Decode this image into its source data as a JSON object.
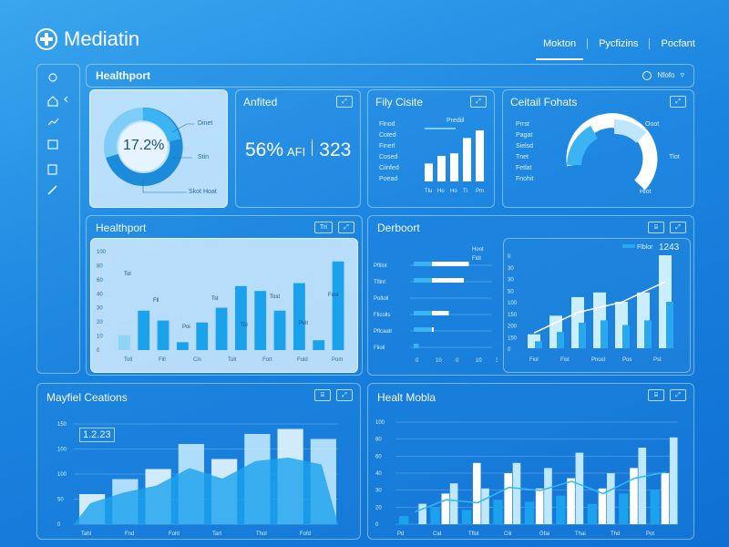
{
  "app": {
    "logo_text": "Mediatin"
  },
  "nav": {
    "items": [
      {
        "label": "Mokton"
      },
      {
        "label": "Pycfizins"
      },
      {
        "label": "Pocfant"
      }
    ]
  },
  "sidebar": {
    "icons": [
      "refresh-icon",
      "home-icon",
      "chart-icon",
      "calendar-icon",
      "document-icon",
      "link-icon"
    ]
  },
  "header": {
    "title": "Healthport",
    "right_label": "Nfofo"
  },
  "cards": {
    "donut": {
      "value": "17.2%",
      "labels": [
        "Dinet",
        "Stin",
        "Skot",
        "Hoat"
      ]
    },
    "kpi": {
      "title": "Anfited",
      "pct": "56%",
      "unit": "AFI",
      "number": "323"
    },
    "daily": {
      "title": "Fily Cisite",
      "legend": [
        "Flnod",
        "Coted",
        "Finerl",
        "Cosed",
        "Ciinfed",
        "Poead"
      ],
      "tag": "Prediil",
      "bars": [
        0.35,
        0.5,
        0.55,
        0.85,
        1.0
      ],
      "xlabels": [
        "Tlu",
        "Ho",
        "Ho",
        "Tl",
        "Pm"
      ]
    },
    "cell": {
      "title": "Ceitail Fohats",
      "legend": [
        "Prrst",
        "Pagat",
        "Sielsd",
        "Tnet",
        "Fetlat",
        "Fnohit"
      ],
      "labels": [
        "Ooot",
        "Tlot",
        "Hlot"
      ]
    }
  },
  "mid_left": {
    "title": "Healthport",
    "btn": "Tri",
    "yticks": [
      "100",
      "80",
      "60",
      "40",
      "30",
      "20",
      "10",
      "0"
    ],
    "xlabels": [
      "Tolt",
      "Fill",
      "Cin",
      "Tolt",
      "Fort",
      "Fold",
      "Pom"
    ],
    "labels": [
      "Tol",
      "Fll",
      "Poi",
      "Tst",
      "Tol",
      "Tost",
      "Pvit",
      "Fost"
    ],
    "series": [
      {
        "name": "light",
        "values": [
          15,
          0,
          8,
          0,
          0,
          21,
          23,
          0,
          0,
          37,
          0,
          0
        ]
      },
      {
        "name": "blue",
        "values": [
          0,
          40,
          30,
          0,
          28,
          43,
          0,
          60,
          40,
          0,
          0,
          0
        ]
      },
      {
        "name": "blue2",
        "values": [
          0,
          0,
          0,
          8,
          0,
          0,
          65,
          0,
          0,
          68,
          10,
          90
        ]
      }
    ]
  },
  "mid_right": {
    "title": "Derboort",
    "hbar_labels": [
      "Pflllot",
      "Tfllnt",
      "Poltoll",
      "Flicolls",
      "Pflcaatr",
      "Flioll"
    ],
    "hbar_values": [
      0.55,
      0.5,
      0.0,
      0.35,
      0.2,
      0.05
    ],
    "hbar_tags": [
      "Hoot",
      "Fldt"
    ],
    "xticks": [
      "0",
      "10",
      "0",
      "10",
      "30"
    ],
    "legend": "Flblor",
    "big_value": "1243",
    "yticks": [
      "0",
      "30",
      "30",
      "50",
      "100",
      "150",
      "200",
      "150",
      "0"
    ],
    "xlabels": [
      "Fiol",
      "Fist",
      "Pnost",
      "Pos",
      "Pst"
    ],
    "bars": [
      0.15,
      0.35,
      0.55,
      0.6,
      0.5,
      0.6,
      1.0
    ],
    "line": [
      0.15,
      0.25,
      0.35,
      0.4,
      0.45,
      0.55,
      0.65
    ]
  },
  "bottom_left": {
    "title": "Mayfiel Ceations",
    "value": "1.2.23",
    "yticks": [
      "150",
      "100",
      "100",
      "50",
      "0"
    ],
    "xlabels": [
      "Tahl",
      "Fnd",
      "Foht",
      "Tart",
      "Thol",
      "Fofd"
    ],
    "bars": [
      0.3,
      0.45,
      0.55,
      0.8,
      0.65,
      0.9,
      0.95,
      0.85
    ]
  },
  "bottom_right": {
    "title": "Healt Mobla",
    "yticks": [
      "100",
      "80",
      "60",
      "40",
      "30",
      "20",
      "0"
    ],
    "xlabels": [
      "Pd",
      "Cat",
      "Tflot",
      "Clir",
      "Gfai",
      "Thai",
      "Thd",
      "Pot"
    ],
    "bars_white": [
      0.0,
      0.3,
      0.6,
      0.5,
      0.35,
      0.45,
      0.35,
      0.55,
      0.5
    ],
    "bars_blue": [
      0.2,
      0.4,
      0.35,
      0.6,
      0.55,
      0.7,
      0.5,
      0.75,
      0.85
    ]
  }
}
